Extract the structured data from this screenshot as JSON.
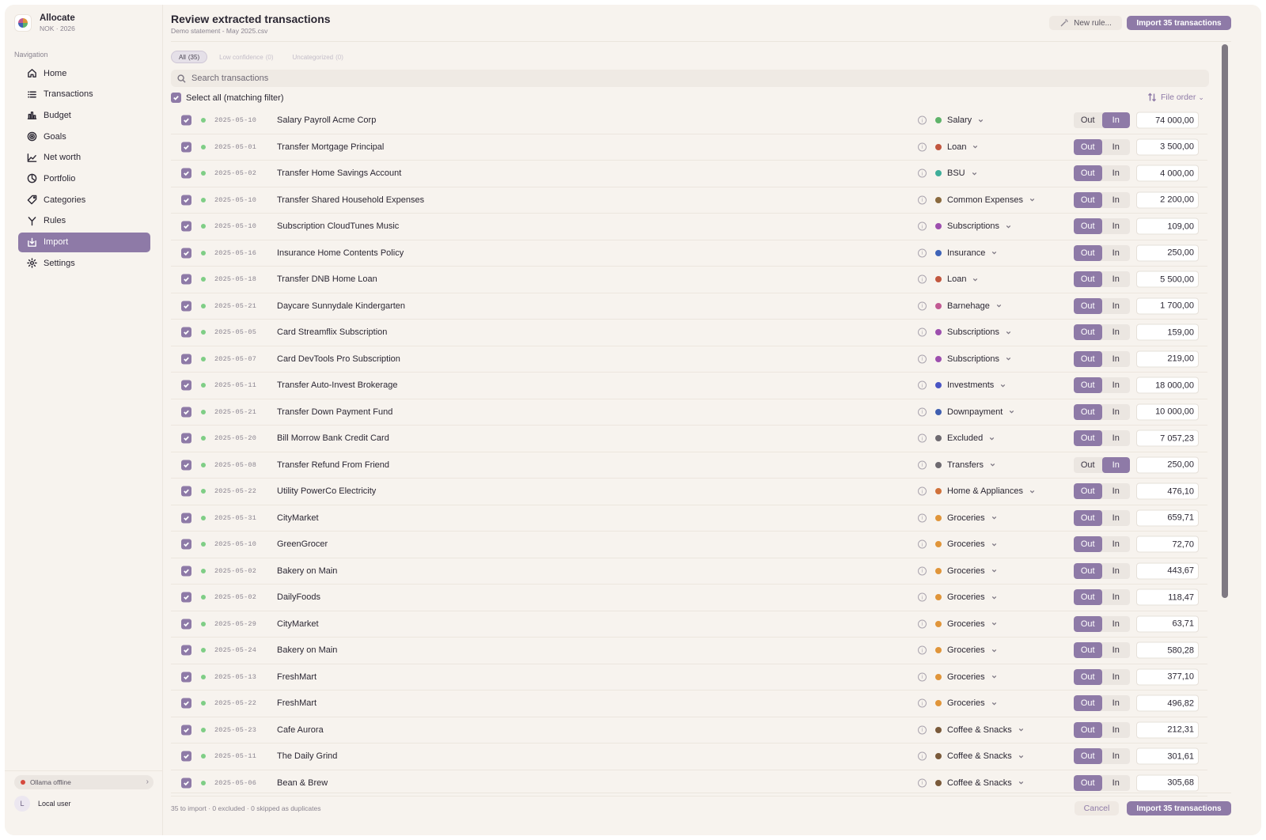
{
  "app": {
    "name": "Allocate",
    "subtitle": "NOK · 2026"
  },
  "sidebar": {
    "heading": "Navigation",
    "items": [
      {
        "label": "Home",
        "icon": "home-icon"
      },
      {
        "label": "Transactions",
        "icon": "list-icon"
      },
      {
        "label": "Budget",
        "icon": "bar-chart-icon"
      },
      {
        "label": "Goals",
        "icon": "target-icon"
      },
      {
        "label": "Net worth",
        "icon": "trend-line-icon"
      },
      {
        "label": "Portfolio",
        "icon": "pie-chart-icon"
      },
      {
        "label": "Categories",
        "icon": "tag-icon"
      },
      {
        "label": "Rules",
        "icon": "branch-icon"
      },
      {
        "label": "Import",
        "icon": "import-icon",
        "active": true
      },
      {
        "label": "Settings",
        "icon": "gear-icon"
      }
    ],
    "status": {
      "label": "Ollama offline",
      "color": "#d64a3e"
    },
    "user": {
      "initial": "L",
      "name": "Local user"
    }
  },
  "header": {
    "title": "Review extracted transactions",
    "subtitle": "Demo statement - May 2025.csv",
    "new_rule_label": "New rule...",
    "import_label": "Import 35 transactions"
  },
  "filters": [
    {
      "label": "All",
      "count": "(35)",
      "active": true
    },
    {
      "label": "Low confidence",
      "count": "(0)",
      "active": false
    },
    {
      "label": "Uncategorized",
      "count": "(0)",
      "active": false
    }
  ],
  "search": {
    "placeholder": "Search transactions"
  },
  "select_all_label": "Select all (matching filter)",
  "sort_label": "File order",
  "toggle_labels": {
    "out": "Out",
    "in": "In"
  },
  "accent_color": "#8e7aa7",
  "transactions": [
    {
      "date": "2025-05-10",
      "description": "Salary  Payroll Acme Corp",
      "category": "Salary",
      "cat_color": "#5fb36a",
      "direction": "in",
      "amount": "74 000,00"
    },
    {
      "date": "2025-05-01",
      "description": "Transfer  Mortgage Principal",
      "category": "Loan",
      "cat_color": "#c2573f",
      "direction": "out",
      "amount": "3 500,00"
    },
    {
      "date": "2025-05-02",
      "description": "Transfer  Home Savings Account",
      "category": "BSU",
      "cat_color": "#3fae9a",
      "direction": "out",
      "amount": "4 000,00"
    },
    {
      "date": "2025-05-10",
      "description": "Transfer  Shared Household Expenses",
      "category": "Common Expenses",
      "cat_color": "#8a6a3e",
      "direction": "out",
      "amount": "2 200,00"
    },
    {
      "date": "2025-05-10",
      "description": "Subscription  CloudTunes Music",
      "category": "Subscriptions",
      "cat_color": "#9d4fae",
      "direction": "out",
      "amount": "109,00"
    },
    {
      "date": "2025-05-16",
      "description": "Insurance  Home Contents Policy",
      "category": "Insurance",
      "cat_color": "#3f64b8",
      "direction": "out",
      "amount": "250,00"
    },
    {
      "date": "2025-05-18",
      "description": "Transfer  DNB Home Loan",
      "category": "Loan",
      "cat_color": "#c2573f",
      "direction": "out",
      "amount": "5 500,00"
    },
    {
      "date": "2025-05-21",
      "description": "Daycare  Sunnydale Kindergarten",
      "category": "Barnehage",
      "cat_color": "#c25a93",
      "direction": "out",
      "amount": "1 700,00"
    },
    {
      "date": "2025-05-05",
      "description": "Card  Streamflix Subscription",
      "category": "Subscriptions",
      "cat_color": "#9d4fae",
      "direction": "out",
      "amount": "159,00"
    },
    {
      "date": "2025-05-07",
      "description": "Card  DevTools Pro Subscription",
      "category": "Subscriptions",
      "cat_color": "#9d4fae",
      "direction": "out",
      "amount": "219,00"
    },
    {
      "date": "2025-05-11",
      "description": "Transfer  Auto-Invest Brokerage",
      "category": "Investments",
      "cat_color": "#4a55c4",
      "direction": "out",
      "amount": "18 000,00"
    },
    {
      "date": "2025-05-21",
      "description": "Transfer  Down Payment Fund",
      "category": "Downpayment",
      "cat_color": "#3f5fb0",
      "direction": "out",
      "amount": "10 000,00"
    },
    {
      "date": "2025-05-20",
      "description": "Bill  Morrow Bank Credit Card",
      "category": "Excluded",
      "cat_color": "#6e6a70",
      "direction": "out",
      "amount": "7 057,23"
    },
    {
      "date": "2025-05-08",
      "description": "Transfer  Refund From Friend",
      "category": "Transfers",
      "cat_color": "#6e6a70",
      "direction": "in",
      "amount": "250,00"
    },
    {
      "date": "2025-05-22",
      "description": "Utility  PowerCo Electricity",
      "category": "Home & Appliances",
      "cat_color": "#d0713a",
      "direction": "out",
      "amount": "476,10"
    },
    {
      "date": "2025-05-31",
      "description": "CityMarket",
      "category": "Groceries",
      "cat_color": "#e0953a",
      "direction": "out",
      "amount": "659,71"
    },
    {
      "date": "2025-05-10",
      "description": "GreenGrocer",
      "category": "Groceries",
      "cat_color": "#e0953a",
      "direction": "out",
      "amount": "72,70"
    },
    {
      "date": "2025-05-02",
      "description": "Bakery on Main",
      "category": "Groceries",
      "cat_color": "#e0953a",
      "direction": "out",
      "amount": "443,67"
    },
    {
      "date": "2025-05-02",
      "description": "DailyFoods",
      "category": "Groceries",
      "cat_color": "#e0953a",
      "direction": "out",
      "amount": "118,47"
    },
    {
      "date": "2025-05-29",
      "description": "CityMarket",
      "category": "Groceries",
      "cat_color": "#e0953a",
      "direction": "out",
      "amount": "63,71"
    },
    {
      "date": "2025-05-24",
      "description": "Bakery on Main",
      "category": "Groceries",
      "cat_color": "#e0953a",
      "direction": "out",
      "amount": "580,28"
    },
    {
      "date": "2025-05-13",
      "description": "FreshMart",
      "category": "Groceries",
      "cat_color": "#e0953a",
      "direction": "out",
      "amount": "377,10"
    },
    {
      "date": "2025-05-22",
      "description": "FreshMart",
      "category": "Groceries",
      "cat_color": "#e0953a",
      "direction": "out",
      "amount": "496,82"
    },
    {
      "date": "2025-05-23",
      "description": "Cafe Aurora",
      "category": "Coffee & Snacks",
      "cat_color": "#7a5a3a",
      "direction": "out",
      "amount": "212,31"
    },
    {
      "date": "2025-05-11",
      "description": "The Daily Grind",
      "category": "Coffee & Snacks",
      "cat_color": "#7a5a3a",
      "direction": "out",
      "amount": "301,61"
    },
    {
      "date": "2025-05-06",
      "description": "Bean & Brew",
      "category": "Coffee & Snacks",
      "cat_color": "#7a5a3a",
      "direction": "out",
      "amount": "305,68"
    }
  ],
  "footer": {
    "summary": "35 to import · 0 excluded · 0 skipped as duplicates",
    "cancel_label": "Cancel",
    "import_label": "Import 35 transactions"
  }
}
